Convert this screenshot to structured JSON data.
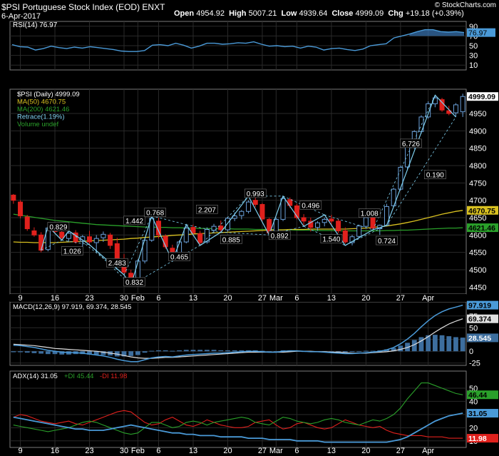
{
  "header": {
    "title": "$PSI Portuguese Stock Index (EOD) ENXT",
    "date": "6-Apr-2017",
    "open_label": "Open",
    "open": "4954.92",
    "high_label": "High",
    "high": "5007.21",
    "low_label": "Low",
    "low": "4939.64",
    "close_label": "Close",
    "close": "4999.09",
    "chg_label": "Chg",
    "chg": "+19.18 (+0.39%)",
    "brand": "© StockCharts.com"
  },
  "colors": {
    "up": "#2f6fb0",
    "down": "#e0211d",
    "ma50": "#d8c020",
    "ma200": "#2aa02a",
    "rsi": "#4a9ad8",
    "macd": "#4a9ad8",
    "signal": "#e0e0e0",
    "adx": "#4a9ad8",
    "pdi": "#2aa02a",
    "mdi": "#e0211d",
    "zig": "#7fd0f0"
  },
  "chart_data": [
    {
      "type": "line",
      "name": "rsi-panel",
      "legend": [
        "RSI(14) 76.97"
      ],
      "ylim": [
        0,
        100
      ],
      "ticks": [
        "90",
        "70",
        "50",
        "30",
        "10"
      ],
      "current_label": "76.97",
      "series": [
        {
          "name": "RSI(14)",
          "values": [
            52,
            48,
            47,
            41,
            44,
            49,
            46,
            44,
            47,
            45,
            48,
            46,
            44,
            42,
            39,
            38,
            38,
            40,
            51,
            52,
            50,
            55,
            51,
            45,
            49,
            55,
            55,
            53,
            54,
            56,
            55,
            58,
            53,
            49,
            50,
            48,
            49,
            45,
            49,
            47,
            41,
            44,
            45,
            42,
            40,
            43,
            50,
            52,
            54,
            66,
            70,
            74,
            79,
            83,
            83,
            79,
            78,
            79,
            77
          ]
        }
      ]
    },
    {
      "type": "candlestick",
      "name": "price-panel",
      "legend": [
        "$PSI (Daily) 4999.09",
        "MA(50) 4670.75",
        "MA(200) 4621.46",
        "Retrace(1.19%)",
        "Volume undef"
      ],
      "ylim": [
        4430,
        5020
      ],
      "ticks": [
        "4950",
        "4900",
        "4850",
        "4800",
        "4750",
        "4700",
        "4650",
        "4600",
        "4550",
        "4500",
        "4450"
      ],
      "x_labels": [
        "9",
        "16",
        "23",
        "30",
        "Feb",
        "6",
        "13",
        "20",
        "27",
        "Mar",
        "6",
        "13",
        "20",
        "27",
        "Apr"
      ],
      "x_label_index": [
        1,
        6,
        11,
        16,
        18,
        21,
        26,
        31,
        36,
        38,
        41,
        46,
        51,
        56,
        60
      ],
      "ohlc": [
        [
          4715,
          4718,
          4690,
          4700
        ],
        [
          4695,
          4700,
          4648,
          4655
        ],
        [
          4652,
          4658,
          4612,
          4618
        ],
        [
          4612,
          4622,
          4595,
          4600
        ],
        [
          4600,
          4608,
          4550,
          4556
        ],
        [
          4558,
          4625,
          4553,
          4620
        ],
        [
          4620,
          4628,
          4605,
          4610
        ],
        [
          4608,
          4616,
          4585,
          4592
        ],
        [
          4590,
          4612,
          4580,
          4605
        ],
        [
          4606,
          4614,
          4575,
          4580
        ],
        [
          4582,
          4600,
          4565,
          4595
        ],
        [
          4595,
          4612,
          4572,
          4580
        ],
        [
          4578,
          4600,
          4550,
          4590
        ],
        [
          4592,
          4610,
          4580,
          4602
        ],
        [
          4600,
          4606,
          4560,
          4570
        ],
        [
          4575,
          4592,
          4520,
          4530
        ],
        [
          4530,
          4545,
          4485,
          4493
        ],
        [
          4490,
          4500,
          4455,
          4462
        ],
        [
          4460,
          4530,
          4452,
          4525
        ],
        [
          4525,
          4590,
          4518,
          4585
        ],
        [
          4585,
          4655,
          4580,
          4648
        ],
        [
          4640,
          4650,
          4590,
          4600
        ],
        [
          4596,
          4602,
          4560,
          4566
        ],
        [
          4562,
          4572,
          4525,
          4535
        ],
        [
          4538,
          4585,
          4530,
          4580
        ],
        [
          4580,
          4625,
          4576,
          4620
        ],
        [
          4622,
          4630,
          4598,
          4606
        ],
        [
          4604,
          4612,
          4570,
          4578
        ],
        [
          4580,
          4622,
          4575,
          4616
        ],
        [
          4614,
          4632,
          4606,
          4625
        ],
        [
          4626,
          4642,
          4608,
          4615
        ],
        [
          4615,
          4652,
          4610,
          4648
        ],
        [
          4648,
          4665,
          4640,
          4655
        ],
        [
          4656,
          4672,
          4645,
          4668
        ],
        [
          4668,
          4700,
          4662,
          4695
        ],
        [
          4700,
          4712,
          4680,
          4688
        ],
        [
          4688,
          4692,
          4640,
          4646
        ],
        [
          4645,
          4650,
          4600,
          4606
        ],
        [
          4604,
          4650,
          4600,
          4645
        ],
        [
          4645,
          4712,
          4640,
          4705
        ],
        [
          4702,
          4708,
          4678,
          4685
        ],
        [
          4684,
          4690,
          4645,
          4650
        ],
        [
          4650,
          4660,
          4625,
          4640
        ],
        [
          4640,
          4650,
          4610,
          4622
        ],
        [
          4622,
          4640,
          4612,
          4635
        ],
        [
          4636,
          4650,
          4625,
          4645
        ],
        [
          4646,
          4658,
          4630,
          4640
        ],
        [
          4640,
          4646,
          4605,
          4612
        ],
        [
          4612,
          4622,
          4575,
          4580
        ],
        [
          4578,
          4600,
          4570,
          4595
        ],
        [
          4596,
          4630,
          4590,
          4626
        ],
        [
          4625,
          4655,
          4620,
          4650
        ],
        [
          4650,
          4660,
          4615,
          4620
        ],
        [
          4618,
          4630,
          4600,
          4628
        ],
        [
          4628,
          4690,
          4625,
          4682
        ],
        [
          4684,
          4736,
          4680,
          4732
        ],
        [
          4732,
          4800,
          4728,
          4795
        ],
        [
          4796,
          4860,
          4790,
          4855
        ],
        [
          4855,
          4902,
          4848,
          4898
        ],
        [
          4898,
          4945,
          4892,
          4940
        ],
        [
          4940,
          4985,
          4935,
          4978
        ],
        [
          4978,
          5003,
          4968,
          4995
        ],
        [
          4990,
          4995,
          4955,
          4960
        ],
        [
          4958,
          4972,
          4945,
          4950
        ],
        [
          4952,
          4980,
          4940,
          4975
        ],
        [
          4955,
          5007,
          4940,
          4999
        ]
      ],
      "ma50": [
        4580,
        4579,
        4579,
        4578,
        4578,
        4578,
        4578,
        4579,
        4580,
        4581,
        4582,
        4583,
        4584,
        4585,
        4586,
        4587,
        4588,
        4590,
        4591,
        4593,
        4594,
        4596,
        4597,
        4599,
        4600,
        4601,
        4603,
        4604,
        4605,
        4606,
        4607,
        4608,
        4609,
        4610,
        4611,
        4612,
        4613,
        4614,
        4615,
        4615,
        4616,
        4616,
        4616,
        4617,
        4617,
        4617,
        4617,
        4617,
        4617,
        4618,
        4619,
        4620,
        4622,
        4624,
        4626,
        4629,
        4632,
        4636,
        4640,
        4645,
        4650,
        4655,
        4660,
        4664,
        4668,
        4671
      ],
      "ma200": [
        4660,
        4657,
        4654,
        4651,
        4648,
        4645,
        4642,
        4640,
        4638,
        4636,
        4634,
        4632,
        4630,
        4629,
        4628,
        4627,
        4626,
        4625,
        4624,
        4623,
        4623,
        4622,
        4622,
        4621,
        4621,
        4620,
        4620,
        4619,
        4619,
        4618,
        4618,
        4618,
        4617,
        4617,
        4617,
        4616,
        4616,
        4616,
        4615,
        4615,
        4615,
        4614,
        4614,
        4614,
        4613,
        4613,
        4613,
        4612,
        4612,
        4612,
        4612,
        4612,
        4612,
        4612,
        4613,
        4613,
        4614,
        4614,
        4615,
        4616,
        4617,
        4618,
        4619,
        4620,
        4620,
        4621
      ],
      "zigzag": [
        [
          4,
          4556
        ],
        [
          5,
          4625
        ],
        [
          7,
          4585
        ],
        [
          8,
          4612
        ],
        [
          11,
          4572
        ],
        [
          16,
          4485
        ],
        [
          17,
          4455
        ],
        [
          20,
          4655
        ],
        [
          23,
          4525
        ],
        [
          25,
          4630
        ],
        [
          27,
          4570
        ],
        [
          30,
          4608
        ],
        [
          34,
          4712
        ],
        [
          37,
          4600
        ],
        [
          39,
          4712
        ],
        [
          42,
          4625
        ],
        [
          45,
          4658
        ],
        [
          48,
          4570
        ],
        [
          52,
          4615
        ],
        [
          54,
          4628
        ],
        [
          61,
          5003
        ],
        [
          64,
          4940
        ]
      ],
      "zig_labels": [
        {
          "text": "0.829",
          "i": 6.5,
          "v": 4622
        },
        {
          "text": "1.026",
          "i": 8.5,
          "v": 4552
        },
        {
          "text": "2.483",
          "i": 15,
          "v": 4518
        },
        {
          "text": "1.442",
          "i": 17.5,
          "v": 4640
        },
        {
          "text": "0.768",
          "i": 20.5,
          "v": 4663
        },
        {
          "text": "0.832",
          "i": 17.5,
          "v": 4463
        },
        {
          "text": "0.465",
          "i": 24,
          "v": 4536
        },
        {
          "text": "2.207",
          "i": 28,
          "v": 4672
        },
        {
          "text": "0.885",
          "i": 31.5,
          "v": 4585
        },
        {
          "text": "0.993",
          "i": 35,
          "v": 4718
        },
        {
          "text": "0.892",
          "i": 38.5,
          "v": 4597
        },
        {
          "text": "0.496",
          "i": 43,
          "v": 4684
        },
        {
          "text": "1.540",
          "i": 46,
          "v": 4587
        },
        {
          "text": "1.008",
          "i": 51.5,
          "v": 4661
        },
        {
          "text": "0.724",
          "i": 54,
          "v": 4582
        },
        {
          "text": "6.726",
          "i": 57.5,
          "v": 4862
        },
        {
          "text": "0.190",
          "i": 61,
          "v": 4772
        }
      ],
      "right_labels": [
        {
          "text": "4999.09",
          "v": 4999,
          "style": "price"
        },
        {
          "text": "4670.75",
          "v": 4671,
          "style": "ma50"
        },
        {
          "text": "4621.46",
          "v": 4621,
          "style": "ma200"
        }
      ]
    },
    {
      "type": "line",
      "name": "macd-panel",
      "legend": [
        "MACD(12,26,9) 97.919, 69.374, 28.545"
      ],
      "ylim": [
        -30,
        105
      ],
      "ticks": [
        "75",
        "50",
        "25",
        "0",
        "-25"
      ],
      "macd": [
        13,
        12,
        10,
        8,
        5,
        2,
        0,
        -2,
        -3,
        -3,
        -4,
        -6,
        -8,
        -10,
        -13,
        -17,
        -20,
        -22,
        -22,
        -18,
        -14,
        -12,
        -11,
        -12,
        -10,
        -8,
        -7,
        -6,
        -5,
        -4,
        -4,
        -3,
        -2,
        -1,
        0,
        0,
        -1,
        -2,
        -2,
        0,
        1,
        1,
        0,
        -1,
        -1,
        -2,
        -3,
        -4,
        -5,
        -5,
        -4,
        -3,
        -2,
        0,
        3,
        8,
        16,
        26,
        38,
        52,
        65,
        76,
        84,
        90,
        94,
        98
      ],
      "signal": [
        15,
        14,
        13,
        12,
        10,
        8,
        6,
        5,
        4,
        3,
        2,
        1,
        0,
        -2,
        -4,
        -6,
        -9,
        -12,
        -14,
        -15,
        -15,
        -14,
        -13,
        -13,
        -12,
        -11,
        -10,
        -9,
        -8,
        -7,
        -6,
        -5,
        -4,
        -3,
        -2,
        -2,
        -2,
        -2,
        -2,
        -2,
        -1,
        0,
        0,
        0,
        -1,
        -1,
        -2,
        -2,
        -3,
        -4,
        -4,
        -4,
        -3,
        -2,
        -1,
        1,
        4,
        8,
        14,
        22,
        31,
        41,
        50,
        58,
        64,
        69
      ],
      "current_labels": [
        {
          "text": "97.919",
          "v": 98,
          "style": "macd"
        },
        {
          "text": "69.374",
          "v": 69,
          "style": "signal"
        },
        {
          "text": "28.545",
          "v": 28.5,
          "style": "hist"
        }
      ]
    },
    {
      "type": "line",
      "name": "adx-panel",
      "legend_adx": "ADX(14) 31.05",
      "legend_pdi": "+DI 45.44",
      "legend_mdi": "-DI 11.98",
      "ylim": [
        5,
        63
      ],
      "ticks": [
        "50",
        "40",
        "30",
        "20",
        "10"
      ],
      "adx": [
        28,
        27,
        26,
        25,
        24,
        23,
        22,
        21,
        20,
        19,
        19,
        18,
        18,
        18,
        19,
        20,
        21,
        22,
        21,
        20,
        19,
        18,
        17,
        16,
        16,
        15,
        15,
        14,
        14,
        14,
        13,
        13,
        13,
        13,
        12,
        12,
        12,
        11,
        11,
        11,
        11,
        10,
        10,
        10,
        10,
        9,
        9,
        9,
        9,
        9,
        9,
        9,
        9,
        9,
        9,
        10,
        11,
        13,
        16,
        19,
        22,
        25,
        27,
        29,
        30,
        31
      ],
      "plus_di": [
        22,
        21,
        20,
        19,
        18,
        17,
        18,
        19,
        20,
        22,
        24,
        25,
        24,
        22,
        20,
        18,
        16,
        15,
        16,
        20,
        24,
        24,
        22,
        20,
        21,
        24,
        25,
        24,
        22,
        24,
        25,
        26,
        27,
        28,
        27,
        24,
        23,
        22,
        25,
        28,
        27,
        25,
        24,
        23,
        24,
        26,
        27,
        26,
        24,
        23,
        22,
        24,
        26,
        25,
        27,
        30,
        35,
        42,
        48,
        54,
        54,
        52,
        50,
        48,
        46,
        45
      ],
      "minus_di": [
        28,
        30,
        29,
        27,
        25,
        24,
        23,
        24,
        25,
        23,
        22,
        24,
        26,
        28,
        30,
        32,
        33,
        32,
        28,
        24,
        22,
        23,
        26,
        28,
        25,
        22,
        21,
        23,
        26,
        24,
        22,
        21,
        20,
        20,
        21,
        24,
        25,
        26,
        22,
        19,
        20,
        23,
        24,
        22,
        20,
        19,
        20,
        23,
        26,
        24,
        22,
        21,
        20,
        21,
        18,
        16,
        15,
        14,
        14,
        14,
        13,
        13,
        13,
        12,
        12,
        12
      ],
      "current_labels": [
        {
          "text": "46.44",
          "v": 45,
          "style": "pdi"
        },
        {
          "text": "31.05",
          "v": 31,
          "style": "adx"
        },
        {
          "text": "11.98",
          "v": 12,
          "style": "mdi"
        }
      ]
    }
  ]
}
